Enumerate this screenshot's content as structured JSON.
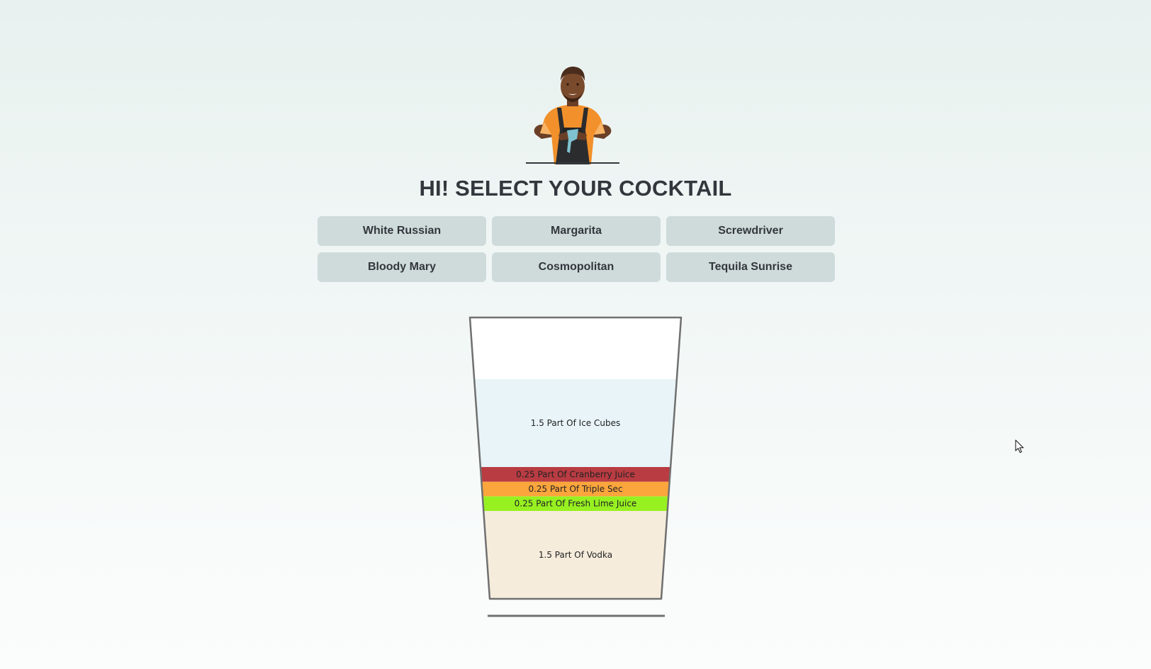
{
  "header": {
    "title": "HI! SELECT YOUR COCKTAIL",
    "avatar_icon": "bartender-icon"
  },
  "cocktails": [
    {
      "label": "White Russian"
    },
    {
      "label": "Margarita"
    },
    {
      "label": "Screwdriver"
    },
    {
      "label": "Bloody Mary"
    },
    {
      "label": "Cosmopolitan"
    },
    {
      "label": "Tequila Sunrise"
    }
  ],
  "glass": {
    "layers": [
      {
        "label": "1.5 Part Of Ice Cubes",
        "parts": 1.5,
        "color": "#e8f4f8"
      },
      {
        "label": "0.25 Part Of Cranberry Juice",
        "parts": 0.25,
        "color": "#b83c42"
      },
      {
        "label": "0.25 Part Of Triple Sec",
        "parts": 0.25,
        "color": "#fba53d"
      },
      {
        "label": "0.25 Part Of Fresh Lime Juice",
        "parts": 0.25,
        "color": "#97f121"
      },
      {
        "label": "1.5 Part Of Vodka",
        "parts": 1.5,
        "color": "#f6ecdc"
      }
    ]
  },
  "colors": {
    "button_bg": "#cfdbdb",
    "title_text": "#33373d",
    "glass_outline": "#707070"
  }
}
